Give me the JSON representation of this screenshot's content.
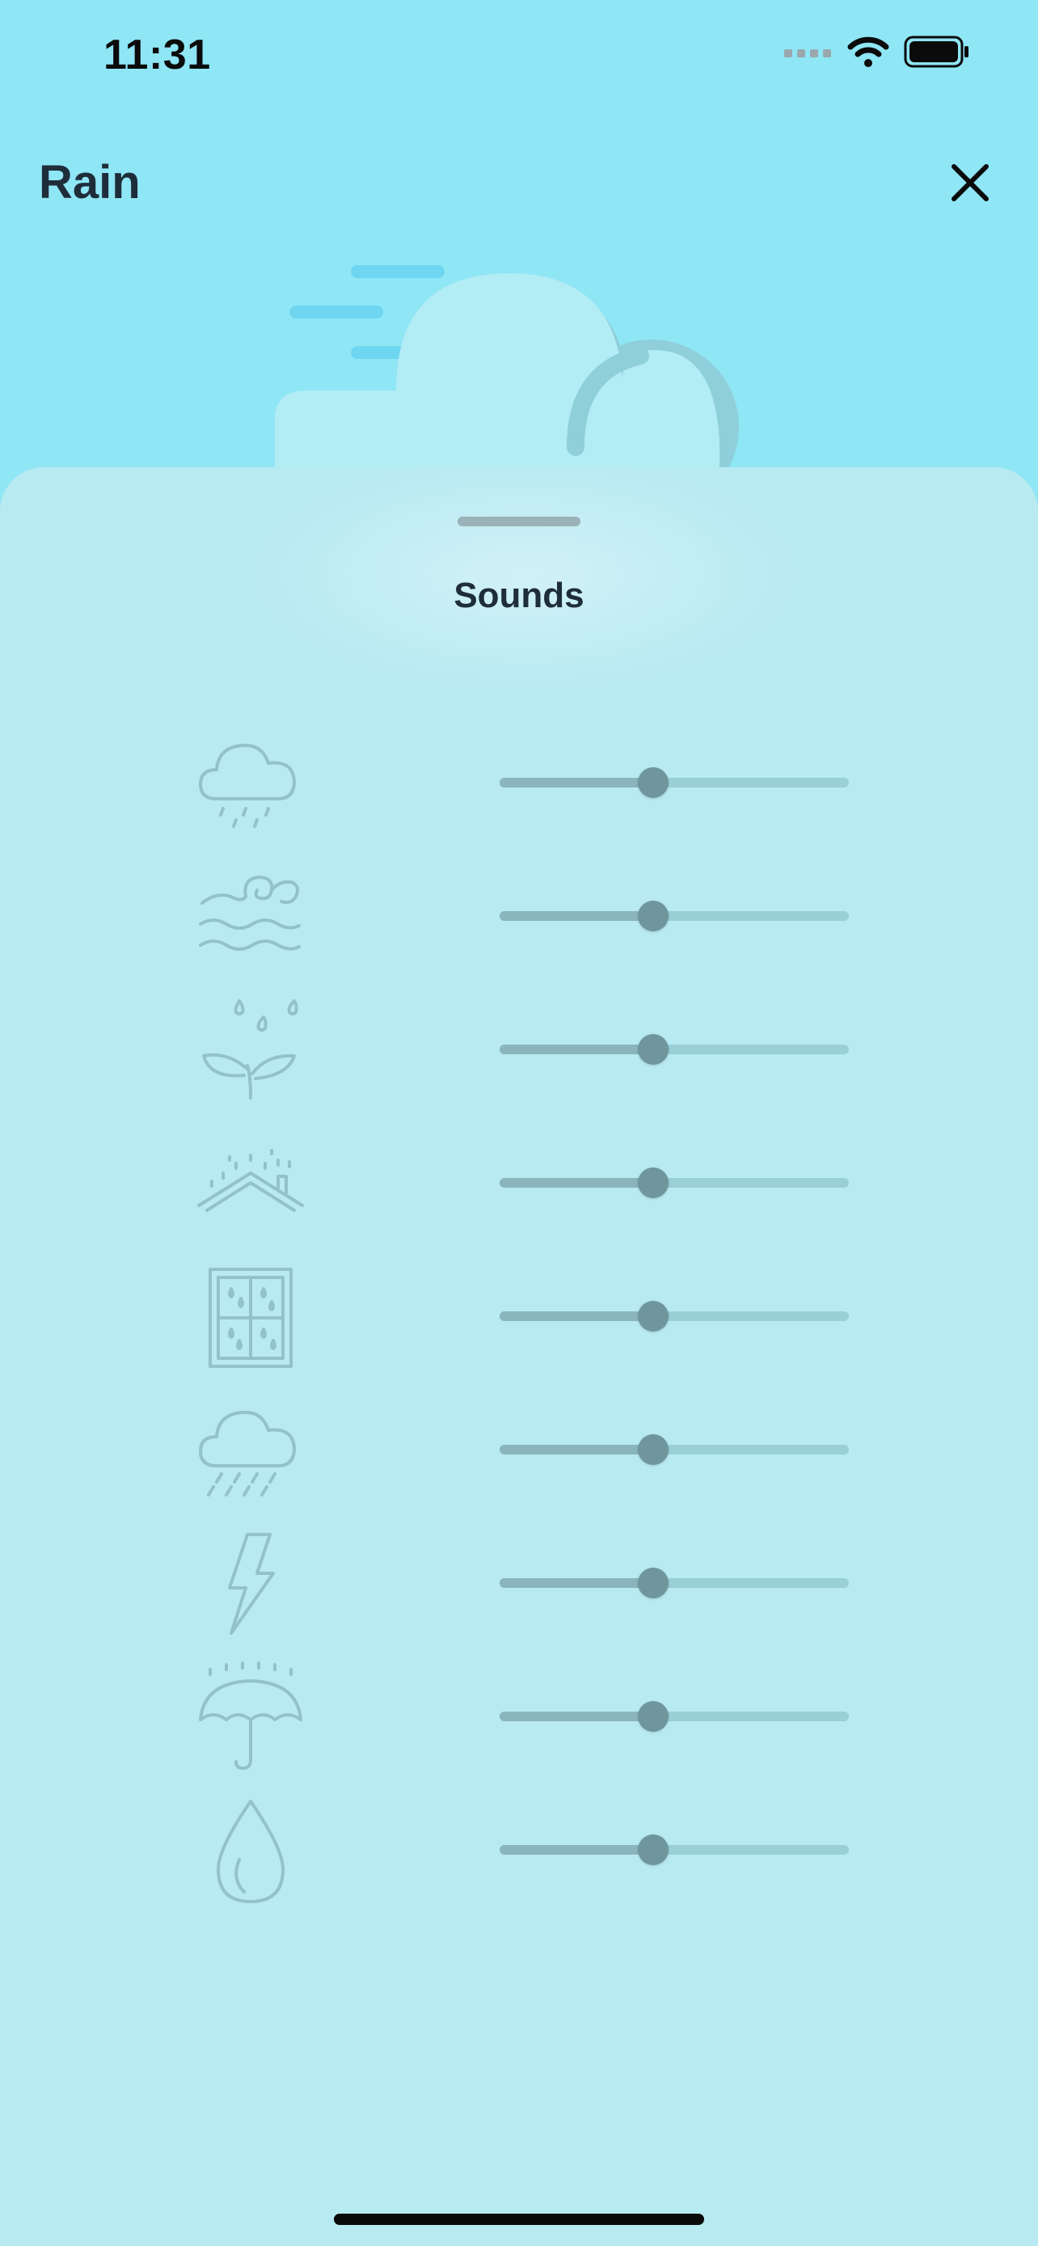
{
  "status_bar": {
    "time": "11:31",
    "icons": [
      "signal-icon",
      "wifi-icon",
      "battery-icon"
    ]
  },
  "header": {
    "title": "Rain",
    "close_icon": "close-icon"
  },
  "hero": {
    "icon": "cloud-illustration"
  },
  "sheet": {
    "title": "Sounds",
    "sounds": [
      {
        "icon": "light-rain-cloud-icon",
        "volume": 0.44
      },
      {
        "icon": "wind-waves-icon",
        "volume": 0.44
      },
      {
        "icon": "rain-on-leaves-icon",
        "volume": 0.44
      },
      {
        "icon": "rain-on-roof-icon",
        "volume": 0.44
      },
      {
        "icon": "rain-on-window-icon",
        "volume": 0.44
      },
      {
        "icon": "heavy-rain-cloud-icon",
        "volume": 0.44
      },
      {
        "icon": "lightning-icon",
        "volume": 0.44
      },
      {
        "icon": "umbrella-rain-icon",
        "volume": 0.44
      },
      {
        "icon": "water-drop-icon",
        "volume": 0.44
      }
    ]
  },
  "colors": {
    "background": "#8fe6f5",
    "sheet": "#b8eaf2",
    "icon_stroke": "#93c2c9",
    "slider_track": "#99cfd6",
    "slider_fill": "#8bb5bd",
    "slider_thumb": "#6f959d"
  }
}
